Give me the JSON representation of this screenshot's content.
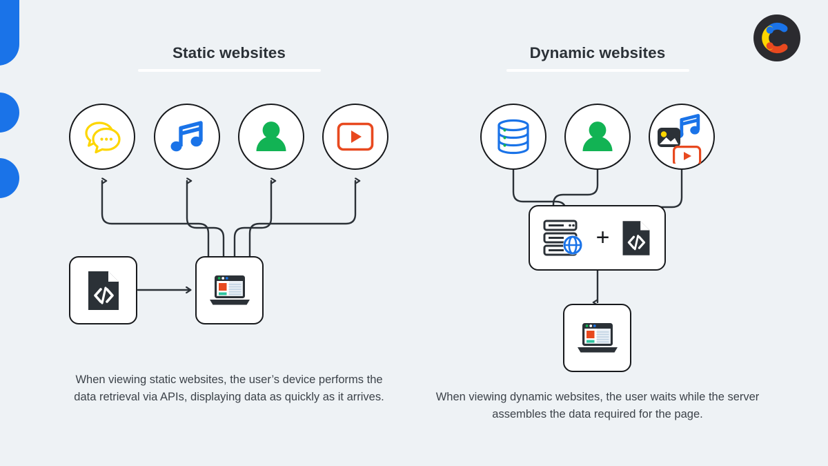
{
  "background_color": "#eef2f5",
  "brand": {
    "logo_name": "contentful-c-logo",
    "logo_bg": "#2b2b2f",
    "logo_arc_colors": [
      "#1a73e8",
      "#fdd600",
      "#e8491f"
    ],
    "accent_blue": "#1a73e8"
  },
  "sections": {
    "static": {
      "title": "Static websites",
      "caption": "When viewing static websites, the user’s device performs the data retrieval via APIs, displaying data as quickly as it arrives.",
      "nodes": [
        {
          "icon": "chat-bubbles-icon",
          "label": "Chat",
          "color": "#fdd600"
        },
        {
          "icon": "music-note-icon",
          "label": "Music",
          "color": "#1a73e8"
        },
        {
          "icon": "user-person-icon",
          "label": "User",
          "color": "#12b354"
        },
        {
          "icon": "video-play-icon",
          "label": "Video",
          "color": "#e8491f"
        }
      ],
      "source_box": {
        "icon": "code-file-icon",
        "label": "Code file"
      },
      "device_box": {
        "icon": "laptop-browser-icon",
        "label": "User device"
      }
    },
    "dynamic": {
      "title": "Dynamic websites",
      "caption": "When viewing dynamic websites, the user waits while the server assembles the data required for the page.",
      "nodes": [
        {
          "icon": "database-icon",
          "label": "Database",
          "color": "#1a73e8"
        },
        {
          "icon": "user-person-icon",
          "label": "User",
          "color": "#12b354"
        },
        {
          "icon": "media-bundle-icon",
          "label": "Media",
          "color": "#1a73e8"
        }
      ],
      "server_box": {
        "server_icon": "server-globe-icon",
        "plus": "+",
        "code_icon": "code-file-icon",
        "label": "Server assembly"
      },
      "device_box": {
        "icon": "laptop-browser-icon",
        "label": "User device"
      }
    }
  }
}
